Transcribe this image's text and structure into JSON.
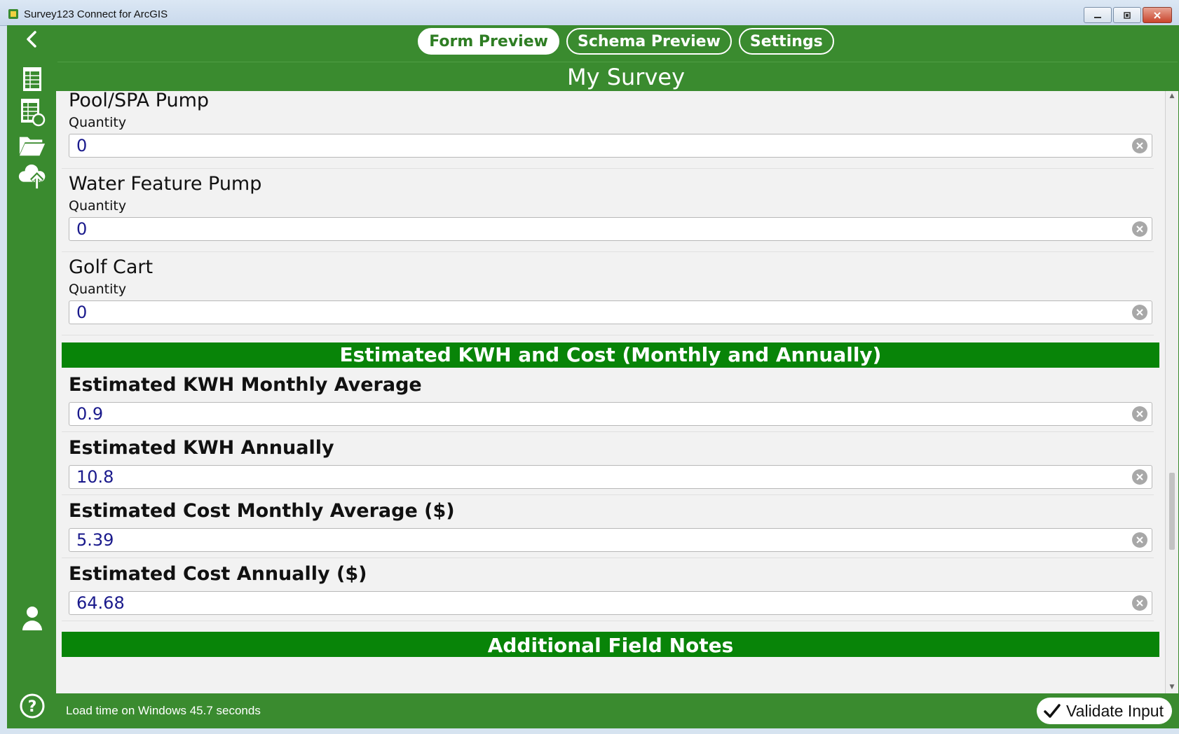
{
  "window": {
    "title": "Survey123 Connect for ArcGIS"
  },
  "header": {
    "tabs": [
      {
        "label": "Form Preview",
        "active": true
      },
      {
        "label": "Schema Preview",
        "active": false
      },
      {
        "label": "Settings",
        "active": false
      }
    ],
    "survey_title": "My Survey"
  },
  "sidebar": {
    "icons": [
      "back-arrow-icon",
      "spreadsheet-icon",
      "spreadsheet-refresh-icon",
      "folder-open-icon",
      "cloud-upload-icon",
      "user-icon",
      "help-icon"
    ]
  },
  "questions": [
    {
      "title": "Pool/SPA Pump",
      "label": "Quantity",
      "value": "0"
    },
    {
      "title": "Water Feature Pump",
      "label": "Quantity",
      "value": "0"
    },
    {
      "title": "Golf Cart",
      "label": "Quantity",
      "value": "0"
    }
  ],
  "group": {
    "title": "Estimated KWH and Cost (Monthly and Annually)",
    "fields": [
      {
        "title": "Estimated KWH Monthly Average",
        "value": "0.9"
      },
      {
        "title": "Estimated KWH Annually",
        "value": "10.8"
      },
      {
        "title": "Estimated Cost Monthly Average ($)",
        "value": "5.39"
      },
      {
        "title": "Estimated Cost Annually ($)",
        "value": "64.68"
      }
    ]
  },
  "next_group": {
    "title": "Additional Field Notes"
  },
  "footer": {
    "status": "Load time on Windows 45.7 seconds",
    "validate_label": "Validate Input"
  },
  "colors": {
    "app_green": "#3a8b2f",
    "group_green": "#088408",
    "value_blue": "#1a1a8c"
  }
}
